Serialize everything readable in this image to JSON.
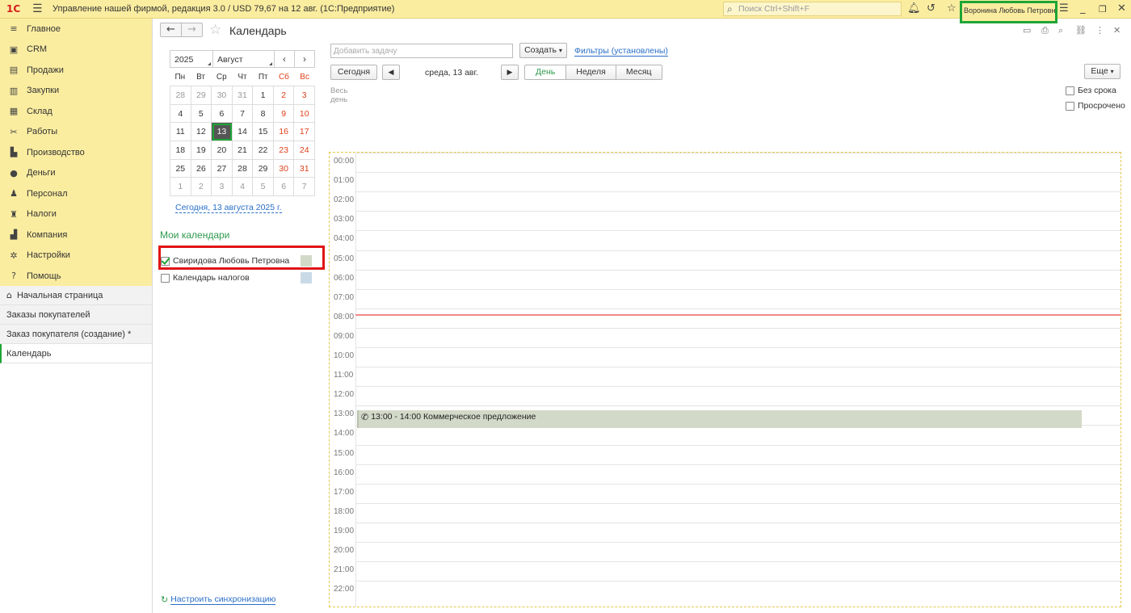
{
  "titlebar": {
    "logo": "1С",
    "title": "Управление нашей фирмой, редакция 3.0 / USD 79,67 на 12 авг.  (1С:Предприятие)",
    "search_placeholder": "Поиск Ctrl+Shift+F",
    "user": "Воронина Любовь Петровна"
  },
  "sidebar": {
    "sections": [
      {
        "label": "Главное",
        "icon": "menu-icon"
      },
      {
        "label": "CRM",
        "icon": "crm-icon"
      },
      {
        "label": "Продажи",
        "icon": "sales-icon"
      },
      {
        "label": "Закупки",
        "icon": "purchases-icon"
      },
      {
        "label": "Склад",
        "icon": "warehouse-icon"
      },
      {
        "label": "Работы",
        "icon": "tools-icon"
      },
      {
        "label": "Производство",
        "icon": "factory-icon"
      },
      {
        "label": "Деньги",
        "icon": "money-icon"
      },
      {
        "label": "Персонал",
        "icon": "person-icon"
      },
      {
        "label": "Налоги",
        "icon": "taxes-icon"
      },
      {
        "label": "Компания",
        "icon": "company-icon"
      },
      {
        "label": "Настройки",
        "icon": "gear-icon"
      },
      {
        "label": "Помощь",
        "icon": "help-icon"
      }
    ],
    "open_windows": [
      {
        "label": "Начальная страница"
      },
      {
        "label": "Заказы покупателей"
      },
      {
        "label": "Заказ покупателя (создание) *"
      },
      {
        "label": "Календарь"
      }
    ]
  },
  "page": {
    "title": "Календарь"
  },
  "mini_calendar": {
    "year": "2025",
    "month": "Август",
    "prev": "‹",
    "next": "›",
    "weekdays": [
      "Пн",
      "Вт",
      "Ср",
      "Чт",
      "Пт",
      "Сб",
      "Вс"
    ],
    "weeks": [
      [
        "28",
        "29",
        "30",
        "31",
        "1",
        "2",
        "3"
      ],
      [
        "4",
        "5",
        "6",
        "7",
        "8",
        "9",
        "10"
      ],
      [
        "11",
        "12",
        "13",
        "14",
        "15",
        "16",
        "17"
      ],
      [
        "18",
        "19",
        "20",
        "21",
        "22",
        "23",
        "24"
      ],
      [
        "25",
        "26",
        "27",
        "28",
        "29",
        "30",
        "31"
      ],
      [
        "1",
        "2",
        "3",
        "4",
        "5",
        "6",
        "7"
      ]
    ],
    "selected_day": "13",
    "today_link": "Сегодня, 13 августа 2025 г."
  },
  "my_calendars": {
    "title": "Мои календари",
    "items": [
      {
        "label": "Свиридова Любовь Петровна",
        "checked": true,
        "color": "#d3d9c8"
      },
      {
        "label": "Календарь налогов",
        "checked": false,
        "color": "#c9dae6"
      }
    ],
    "sync_link": "Настроить синхронизацию"
  },
  "toolbar": {
    "task_placeholder": "Добавить задачу",
    "create_label": "Создать",
    "filters_label": "Фильтры (установлены)",
    "today_label": "Сегодня",
    "date_label": "среда, 13 авг.",
    "views": [
      "День",
      "Неделя",
      "Месяц"
    ],
    "active_view": "День",
    "more_label": "Еще",
    "allday_label": "Весь день",
    "no_deadline": "Без срока",
    "overdue": "Просрочено"
  },
  "day_view": {
    "hours": [
      "00:00",
      "01:00",
      "02:00",
      "03:00",
      "04:00",
      "05:00",
      "06:00",
      "07:00",
      "08:00",
      "09:00",
      "10:00",
      "11:00",
      "12:00",
      "13:00",
      "14:00",
      "15:00",
      "16:00",
      "17:00",
      "18:00",
      "19:00",
      "20:00",
      "21:00",
      "22:00"
    ],
    "events": [
      {
        "time": "13:00 - 14:00",
        "title": "Коммерческое предложение",
        "icon": "phone-icon"
      }
    ]
  },
  "colors": {
    "accent_yellow": "#fbeda0",
    "accent_green": "#1ea536",
    "weekend_red": "#e0401a",
    "highlight_red": "#e01414"
  }
}
